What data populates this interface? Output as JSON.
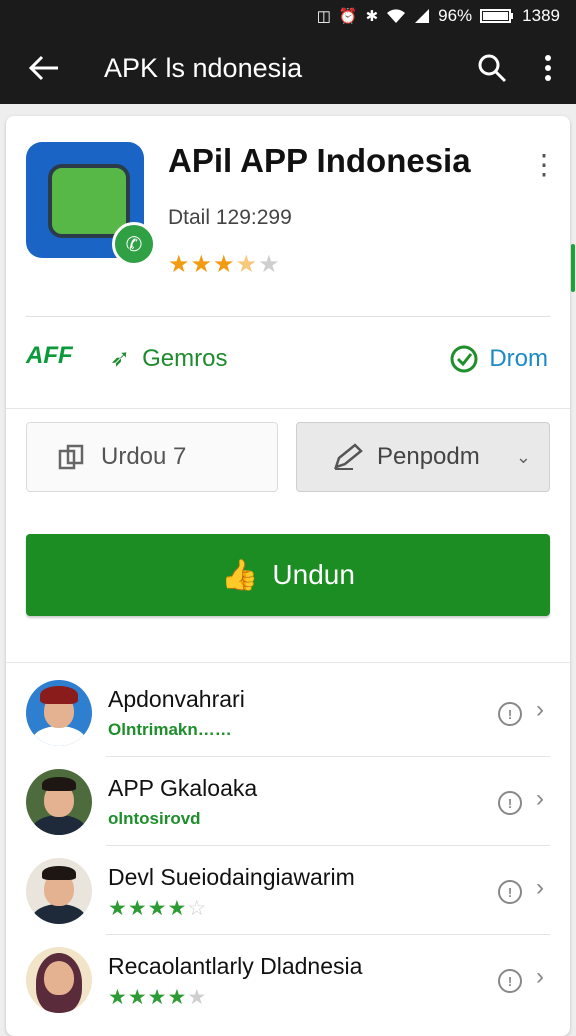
{
  "status_bar": {
    "battery": "96%",
    "time": "1389",
    "icons": [
      "nfc-icon",
      "alarm-icon",
      "bluetooth-icon",
      "wifi-icon",
      "signal-icon",
      "battery-icon"
    ]
  },
  "app_bar": {
    "title": "APK ls ndonesia",
    "icons": [
      "back-arrow-icon",
      "search-icon",
      "overflow-menu-icon"
    ]
  },
  "header": {
    "app_name": "APil APP Indonesia",
    "detail": "Dtail 129:299",
    "rating": 3.5
  },
  "badges": {
    "apk_label": "AFF",
    "genre_label": "Gemros",
    "drom_label": "Drom"
  },
  "buttons": {
    "outline_label": "Urdou 7",
    "select_label": "Penpodm",
    "primary_label": "Undun"
  },
  "list": [
    {
      "title": "Apdonvahrari",
      "subtitle": "Olntrimakn……",
      "avatar": "man-red-hat"
    },
    {
      "title": "APP Gkaloaka",
      "subtitle": "olntosirovd",
      "avatar": "man-suit"
    },
    {
      "title": "Devl Sueiodaingiawarim",
      "rating": 4,
      "avatar": "man-suit-2"
    },
    {
      "title": "Recaolantlarly Dladnesia",
      "rating": 4,
      "avatar": "woman-hijab"
    }
  ],
  "colors": {
    "primary_green": "#1c8d22",
    "star_orange": "#f29a12",
    "accent_blue": "#1b8ac9",
    "app_bar": "#1b1b1b"
  }
}
